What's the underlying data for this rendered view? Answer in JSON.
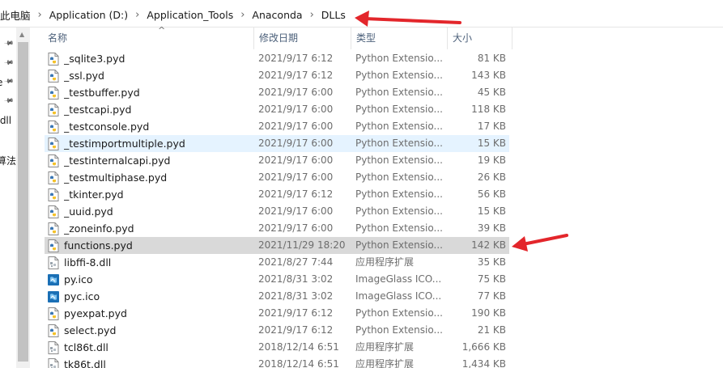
{
  "address": {
    "path": [
      "此电脑",
      "Application (D:)",
      "Application_Tools",
      "Anaconda",
      "DLLs"
    ],
    "separator": "›"
  },
  "nav": {
    "items": [
      {
        "label": "",
        "pinned": true
      },
      {
        "label": "",
        "pinned": true
      },
      {
        "label": "e",
        "pinned": true
      },
      {
        "label": "",
        "pinned": true
      },
      {
        "label": ".dll",
        "pinned": false
      },
      {
        "label": "算法",
        "pinned": false
      }
    ]
  },
  "columns": {
    "name": "名称",
    "date": "修改日期",
    "type": "类型",
    "size": "大小"
  },
  "files": [
    {
      "name": "_sqlite3.pyd",
      "date": "2021/9/17 6:12",
      "type": "Python Extensio...",
      "size": "81 KB",
      "icon": "python-file-icon",
      "state": ""
    },
    {
      "name": "_ssl.pyd",
      "date": "2021/9/17 6:12",
      "type": "Python Extensio...",
      "size": "143 KB",
      "icon": "python-file-icon",
      "state": ""
    },
    {
      "name": "_testbuffer.pyd",
      "date": "2021/9/17 6:00",
      "type": "Python Extensio...",
      "size": "45 KB",
      "icon": "python-file-icon",
      "state": ""
    },
    {
      "name": "_testcapi.pyd",
      "date": "2021/9/17 6:00",
      "type": "Python Extensio...",
      "size": "118 KB",
      "icon": "python-file-icon",
      "state": ""
    },
    {
      "name": "_testconsole.pyd",
      "date": "2021/9/17 6:00",
      "type": "Python Extensio...",
      "size": "17 KB",
      "icon": "python-file-icon",
      "state": ""
    },
    {
      "name": "_testimportmultiple.pyd",
      "date": "2021/9/17 6:00",
      "type": "Python Extensio...",
      "size": "15 KB",
      "icon": "python-file-icon",
      "state": "hover"
    },
    {
      "name": "_testinternalcapi.pyd",
      "date": "2021/9/17 6:00",
      "type": "Python Extensio...",
      "size": "19 KB",
      "icon": "python-file-icon",
      "state": ""
    },
    {
      "name": "_testmultiphase.pyd",
      "date": "2021/9/17 6:00",
      "type": "Python Extensio...",
      "size": "26 KB",
      "icon": "python-file-icon",
      "state": ""
    },
    {
      "name": "_tkinter.pyd",
      "date": "2021/9/17 6:12",
      "type": "Python Extensio...",
      "size": "56 KB",
      "icon": "python-file-icon",
      "state": ""
    },
    {
      "name": "_uuid.pyd",
      "date": "2021/9/17 6:00",
      "type": "Python Extensio...",
      "size": "15 KB",
      "icon": "python-file-icon",
      "state": ""
    },
    {
      "name": "_zoneinfo.pyd",
      "date": "2021/9/17 6:00",
      "type": "Python Extensio...",
      "size": "39 KB",
      "icon": "python-file-icon",
      "state": ""
    },
    {
      "name": "functions.pyd",
      "date": "2021/11/29 18:20",
      "type": "Python Extensio...",
      "size": "142 KB",
      "icon": "python-file-icon",
      "state": "selected"
    },
    {
      "name": "libffi-8.dll",
      "date": "2021/8/27 7:44",
      "type": "应用程序扩展",
      "size": "35 KB",
      "icon": "dll-file-icon",
      "state": ""
    },
    {
      "name": "py.ico",
      "date": "2021/8/31 3:02",
      "type": "ImageGlass ICO...",
      "size": "75 KB",
      "icon": "imageglass-icon",
      "state": ""
    },
    {
      "name": "pyc.ico",
      "date": "2021/8/31 3:02",
      "type": "ImageGlass ICO...",
      "size": "77 KB",
      "icon": "imageglass-icon",
      "state": ""
    },
    {
      "name": "pyexpat.pyd",
      "date": "2021/9/17 6:12",
      "type": "Python Extensio...",
      "size": "190 KB",
      "icon": "python-file-icon",
      "state": ""
    },
    {
      "name": "select.pyd",
      "date": "2021/9/17 6:12",
      "type": "Python Extensio...",
      "size": "21 KB",
      "icon": "python-file-icon",
      "state": ""
    },
    {
      "name": "tcl86t.dll",
      "date": "2018/12/14 6:51",
      "type": "应用程序扩展",
      "size": "1,666 KB",
      "icon": "dll-file-icon",
      "state": ""
    },
    {
      "name": "tk86t.dll",
      "date": "2018/12/14 6:51",
      "type": "应用程序扩展",
      "size": "1,434 KB",
      "icon": "dll-file-icon",
      "state": ""
    }
  ],
  "colors": {
    "annotation_arrow": "#e3262b",
    "hover_row": "#e5f3ff",
    "selected_row": "#d9d9d9",
    "header_text": "#4c607a",
    "meta_text": "#6d6d6d"
  }
}
